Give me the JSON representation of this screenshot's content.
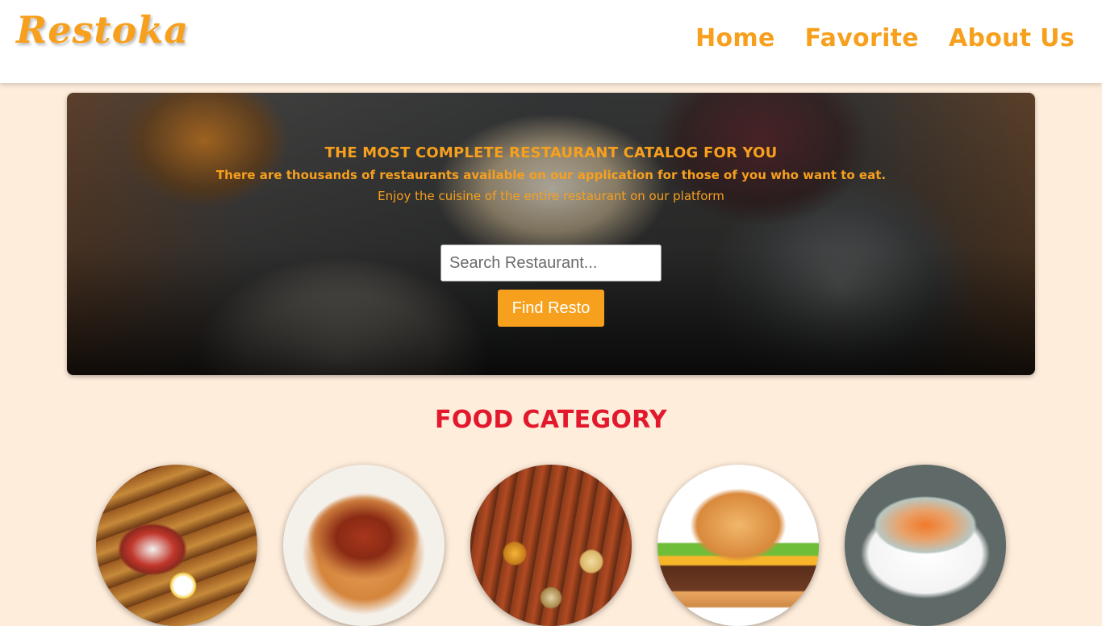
{
  "navbar": {
    "brand": "Restoka",
    "links": [
      {
        "label": "Home"
      },
      {
        "label": "Favorite"
      },
      {
        "label": "About Us"
      }
    ]
  },
  "hero": {
    "title": "THE MOST COMPLETE RESTAURANT CATALOG FOR YOU",
    "subtitle": "There are thousands of restaurants available on our application for those of you who want to eat.",
    "tagline": "Enjoy the cuisine of the entire restaurant on our platform",
    "search": {
      "placeholder": "Search Restaurant...",
      "value": ""
    },
    "find_button": "Find Resto"
  },
  "food_category": {
    "title": "FOOD CATEGORY",
    "items": [
      {
        "image": "satay-image"
      },
      {
        "image": "spaghetti-image"
      },
      {
        "image": "platter-image"
      },
      {
        "image": "burger-image"
      },
      {
        "image": "soup-image"
      }
    ]
  },
  "colors": {
    "accent": "#F7A01E",
    "heading_red": "#E3182C",
    "page_bg": "#FFEDDB",
    "navbar_bg": "#FFFFFF"
  }
}
